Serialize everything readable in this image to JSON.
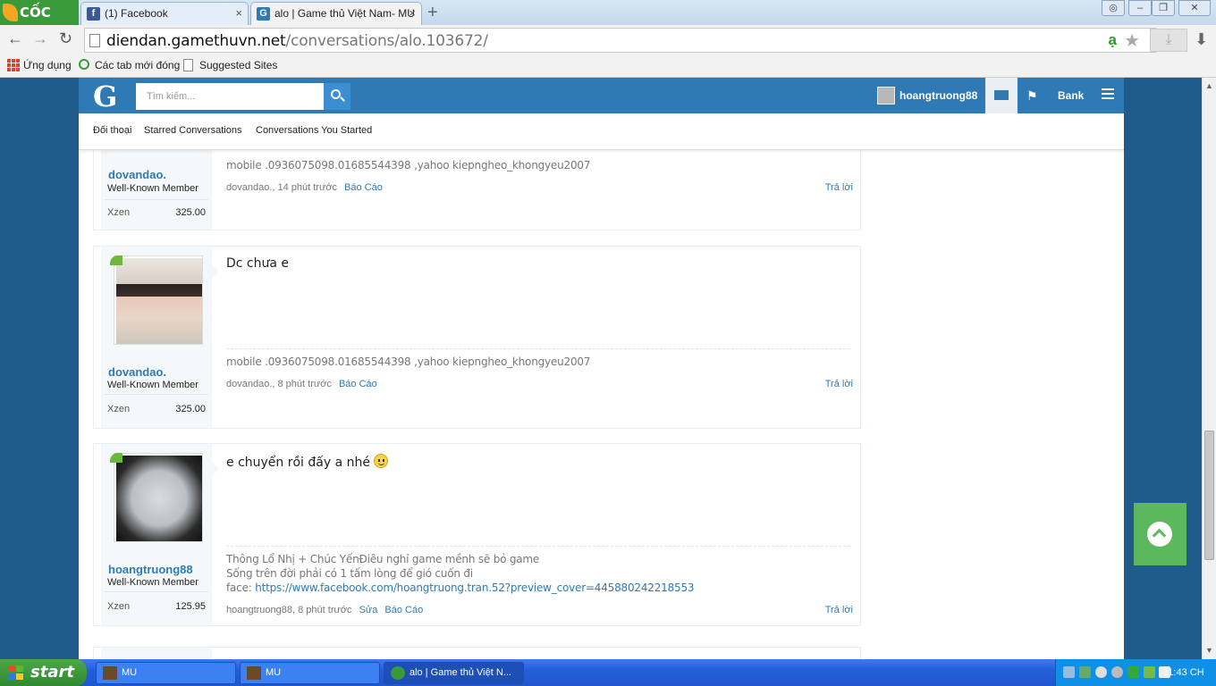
{
  "browser": {
    "brand": "CỐC CỐC",
    "tabs": [
      {
        "label": "(1) Facebook",
        "icon": "facebook-icon"
      },
      {
        "label": "alo | Game thủ Việt Nam- MU",
        "icon": "gamethuvn-icon"
      }
    ],
    "url_host": "diendan.gamethuvn.net",
    "url_path": "/conversations/alo.103672/",
    "bookmarks": [
      "Ứng dụng",
      "Các tab mới đóng",
      "Suggested Sites"
    ]
  },
  "site": {
    "search_placeholder": "Tìm kiếm...",
    "username": "hoangtruong88",
    "bank_label": "Bank",
    "subnav": [
      "Đối thoại",
      "Starred Conversations",
      "Conversations You Started"
    ]
  },
  "messages": [
    {
      "author": "dovandao.",
      "title": "Well-Known Member",
      "xzen_label": "Xzen",
      "xzen": "325.00",
      "text": "",
      "signature": [
        "mobile .0936075098.01685544398 ,yahoo kiepngheo_khongyeu2007"
      ],
      "meta_author": "dovandao., 14 phút trước",
      "actions": [
        "Báo Cáo"
      ],
      "reply": "Trả lời"
    },
    {
      "author": "dovandao.",
      "title": "Well-Known Member",
      "xzen_label": "Xzen",
      "xzen": "325.00",
      "text": "Dc chưa e",
      "signature": [
        "mobile .0936075098.01685544398 ,yahoo kiepngheo_khongyeu2007"
      ],
      "meta_author": "dovandao., 8 phút trước",
      "actions": [
        "Báo Cáo"
      ],
      "reply": "Trả lời"
    },
    {
      "author": "hoangtruong88",
      "title": "Well-Known Member",
      "xzen_label": "Xzen",
      "xzen": "125.95",
      "text": "e chuyển rồi đấy a nhé",
      "signature": [
        "Thông Lổ Nhị + Chúc YếnĐiêu nghỉ game mềnh sẽ bỏ game",
        "Sống trên đời phải có 1 tấm lòng để gió cuốn đi"
      ],
      "sig_link_prefix": "face: ",
      "sig_link": "https://www.facebook.com/hoangtruong.tran.52?preview_cover=445880242218553",
      "meta_author": "hoangtruong88, 8 phút trước",
      "actions": [
        "Sửa",
        "Báo Cáo"
      ],
      "reply": "Trả lời"
    }
  ],
  "taskbar": {
    "start": "start",
    "tasks": [
      "MU",
      "MU",
      "alo | Game thủ Việt N..."
    ],
    "clock": "11:43 CH"
  },
  "colors": {
    "header_blue": "#2f7ab5",
    "link_blue": "#2f7ab5",
    "scroll_top_green": "#5cb85c",
    "online_green": "#6cb83a"
  }
}
